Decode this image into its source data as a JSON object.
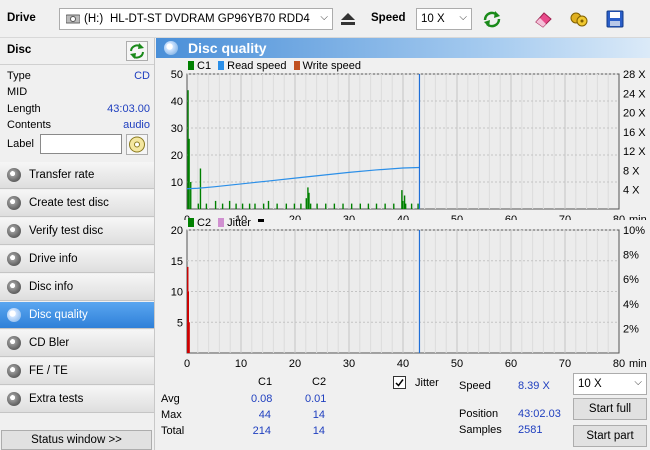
{
  "toolbar": {
    "drive_label": "Drive",
    "drive_letter": "(H:)",
    "drive_name": "HL-DT-ST DVDRAM GP96YB70 RDD4",
    "speed_label": "Speed",
    "speed_value": "10 X"
  },
  "disc": {
    "title": "Disc",
    "rows": [
      {
        "key": "Type",
        "value": "CD"
      },
      {
        "key": "MID",
        "value": ""
      },
      {
        "key": "Length",
        "value": "43:03.00"
      },
      {
        "key": "Contents",
        "value": "audio"
      }
    ],
    "label_key": "Label",
    "label_value": ""
  },
  "nav": [
    {
      "label": "Transfer rate"
    },
    {
      "label": "Create test disc"
    },
    {
      "label": "Verify test disc"
    },
    {
      "label": "Drive info"
    },
    {
      "label": "Disc info"
    },
    {
      "label": "Disc quality",
      "active": true
    },
    {
      "label": "CD Bler"
    },
    {
      "label": "FE / TE"
    },
    {
      "label": "Extra tests"
    }
  ],
  "status_window": "Status window >>",
  "panel_title": "Disc quality",
  "colors": {
    "c1": "#008000",
    "read": "#2b8fe8",
    "write": "#c05020",
    "c2": "#d00000",
    "jitter": "#d090d0",
    "marker": "#1f6fd8"
  },
  "chart_data": [
    {
      "type": "bar",
      "legend": [
        "C1",
        "Read speed",
        "Write speed"
      ],
      "xlabel": "min",
      "xticks": [
        "0",
        "10",
        "20",
        "30",
        "40",
        "50",
        "60",
        "70",
        "80"
      ],
      "xlim": [
        0,
        80
      ],
      "yticks_left": [
        "10",
        "20",
        "30",
        "40",
        "50"
      ],
      "ylim_left": [
        0,
        50
      ],
      "yticks_right": [
        "4 X",
        "8 X",
        "12 X",
        "16 X",
        "20 X",
        "24 X",
        "28 X"
      ],
      "ylim_right": [
        0,
        28
      ],
      "c1_x": [
        0.1,
        0.3,
        0.6,
        2.0,
        2.4,
        3.5,
        5.2,
        6.5,
        7.8,
        9.0,
        10.2,
        11.5,
        12.5,
        14.1,
        15.0,
        16.6,
        18.3,
        19.8,
        21.0,
        22.0,
        22.3,
        22.5,
        22.8,
        24.0,
        25.6,
        27.2,
        28.8,
        30.4,
        32.0,
        33.5,
        35.0,
        36.6,
        38.2,
        39.7,
        39.9,
        40.2,
        40.4,
        41.5,
        42.7
      ],
      "c1_y": [
        44,
        26,
        10,
        2,
        15,
        2,
        3,
        2,
        3,
        2,
        2,
        2,
        2,
        2,
        3,
        2,
        2,
        2,
        2,
        4,
        8,
        6,
        2,
        2,
        2,
        2,
        2,
        2,
        2,
        2,
        2,
        2,
        2,
        7,
        3,
        5,
        2,
        2,
        2
      ],
      "read_x": [
        0,
        2,
        5,
        10,
        15,
        20,
        25,
        30,
        35,
        40,
        43.05
      ],
      "read_y": [
        4.2,
        4.3,
        4.6,
        5.2,
        5.8,
        6.4,
        7.0,
        7.6,
        8.1,
        8.5,
        8.6
      ],
      "marker_x": 43.05
    },
    {
      "type": "bar",
      "legend": [
        "C2",
        "Jitter"
      ],
      "xlabel": "min",
      "xticks": [
        "0",
        "10",
        "20",
        "30",
        "40",
        "50",
        "60",
        "70",
        "80"
      ],
      "xlim": [
        0,
        80
      ],
      "yticks_left": [
        "5",
        "10",
        "15",
        "20"
      ],
      "ylim_left": [
        0,
        20
      ],
      "yticks_right": [
        "2%",
        "4%",
        "6%",
        "8%",
        "10%"
      ],
      "ylim_right": [
        0,
        10
      ],
      "c2_x": [
        0.05,
        0.15,
        0.3
      ],
      "c2_y": [
        14,
        10,
        5
      ],
      "marker_x": 43.05
    }
  ],
  "stats": {
    "col_c1": "C1",
    "col_c2": "C2",
    "rows": [
      {
        "label": "Avg",
        "c1": "0.08",
        "c2": "0.01"
      },
      {
        "label": "Max",
        "c1": "44",
        "c2": "14"
      },
      {
        "label": "Total",
        "c1": "214",
        "c2": "14"
      }
    ],
    "jitter_label": "Jitter",
    "jitter_checked": true,
    "speed_label": "Speed",
    "speed_value": "8.39 X",
    "position_label": "Position",
    "position_value": "43:02.03",
    "samples_label": "Samples",
    "samples_value": "2581",
    "speed_select": "10 X",
    "start_full": "Start full",
    "start_part": "Start part"
  }
}
